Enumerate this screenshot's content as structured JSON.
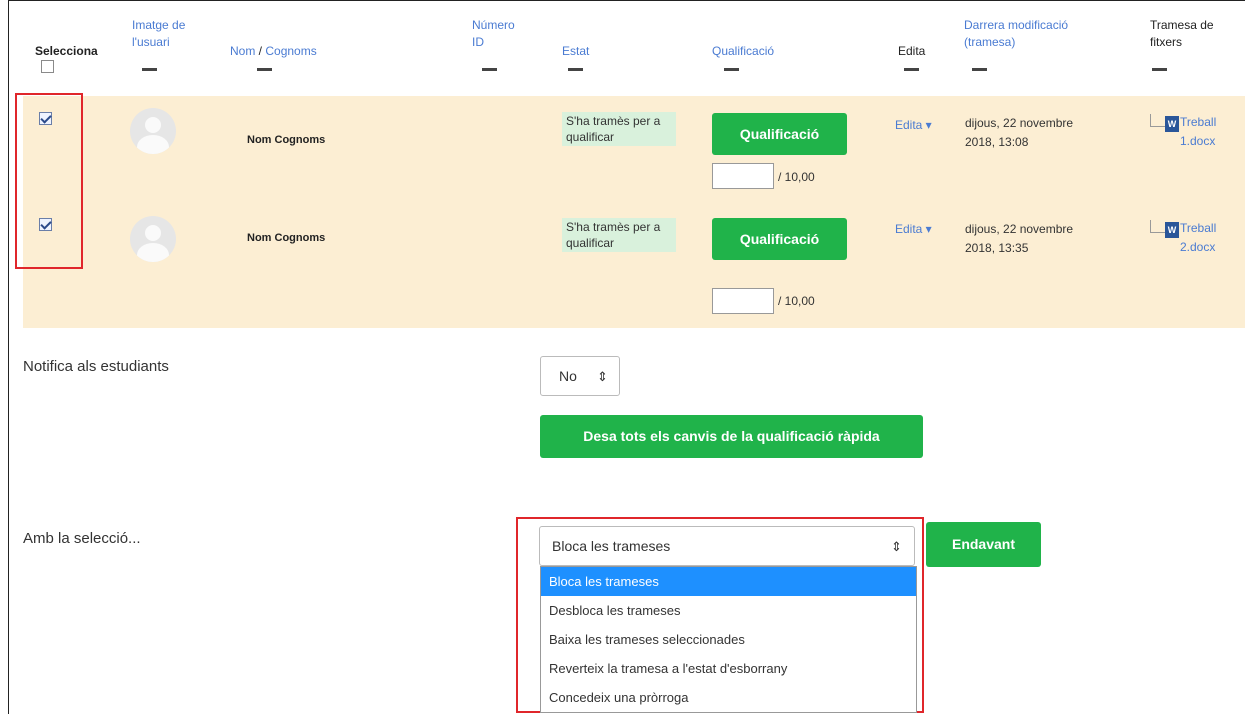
{
  "table": {
    "headers": {
      "select": "Selecciona",
      "image": "Imatge de l'usuari",
      "name_first": "Nom",
      "name_sep": " / ",
      "name_last": "Cognoms",
      "id": "Número ID",
      "status": "Estat",
      "grade": "Qualificació",
      "edit": "Edita",
      "modified": "Darrera modificació (tramesa)",
      "files": "Tramesa de fitxers"
    },
    "rows": [
      {
        "name": "Nom Cognoms",
        "status": "S'ha tramès per a qualificar",
        "grade_button": "Qualificació",
        "grade_value": "",
        "grade_max": "/ 10,00",
        "edit_menu": "Edita ▾",
        "modified": "dijous, 22 novembre 2018, 13:08",
        "file": "Treball 1.docx",
        "checked": true
      },
      {
        "name": "Nom Cognoms",
        "status": "S'ha tramès per a qualificar",
        "grade_button": "Qualificació",
        "grade_value": "",
        "grade_max": "/ 10,00",
        "edit_menu": "Edita ▾",
        "modified": "dijous, 22 novembre 2018, 13:35",
        "file": "Treball 2.docx",
        "checked": true
      }
    ]
  },
  "notify": {
    "label": "Notifica als estudiants",
    "value": "No",
    "arrows": "⇕"
  },
  "save_button": "Desa tots els canvis de la qualificació ràpida",
  "selection": {
    "label": "Amb la selecció...",
    "value": "Bloca les trameses",
    "go_button": "Endavant",
    "options": [
      "Bloca les trameses",
      "Desbloca les trameses",
      "Baixa les trameses seleccionades",
      "Reverteix la tramesa a l'estat d'esborrany",
      "Concedeix una pròrroga"
    ]
  },
  "colors": {
    "row_highlight": "#fceed3",
    "accent_green": "#20b34a",
    "link_blue": "#4a7bd2",
    "annotation_red": "#e0262b",
    "selected_option": "#1e90ff"
  },
  "icons": {
    "file_type": "W"
  }
}
